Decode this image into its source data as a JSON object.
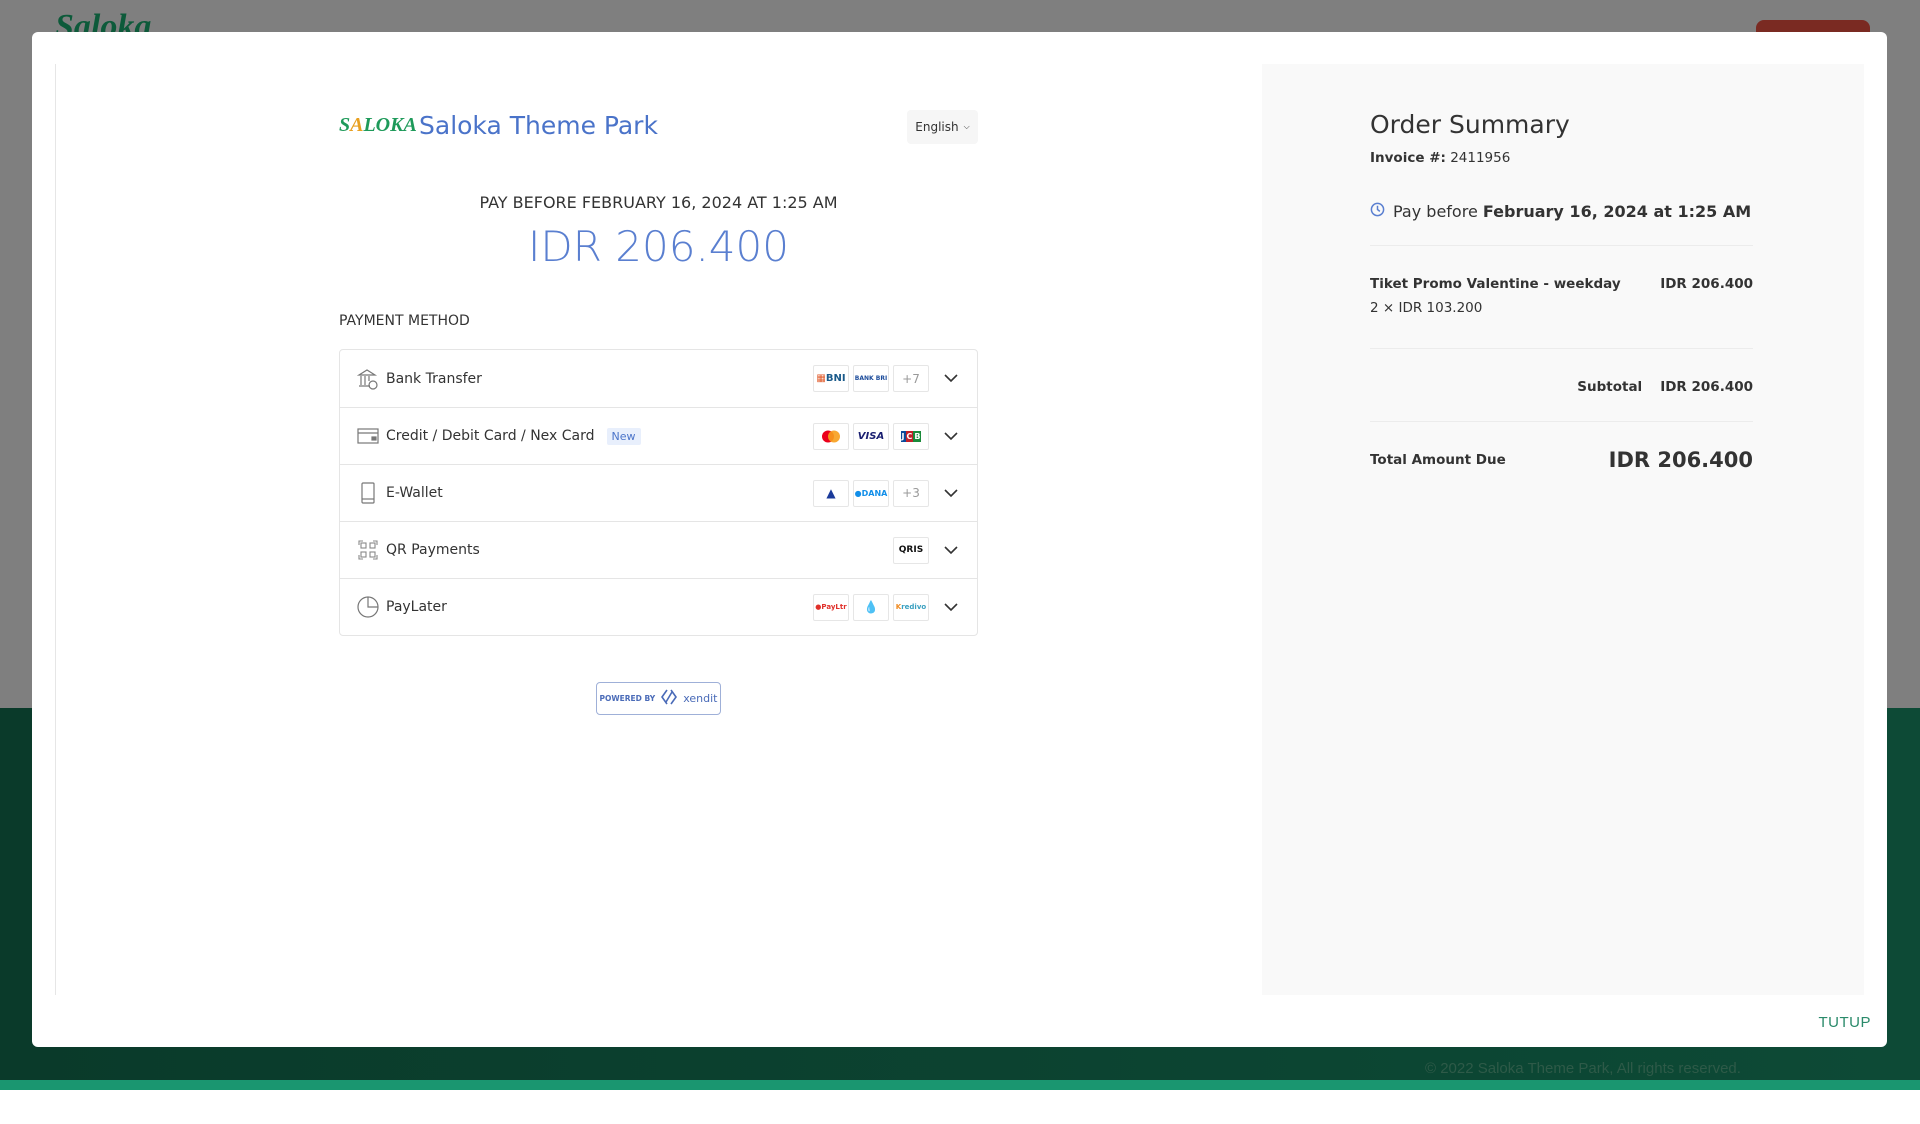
{
  "background": {
    "logo": "Saloka",
    "copyright": "© 2022 Saloka Theme Park, All rights reserved."
  },
  "header": {
    "logo_text": "Saloka",
    "brand": "Saloka Theme Park",
    "language": "English"
  },
  "payment": {
    "pay_before": "PAY BEFORE FEBRUARY 16, 2024 AT 1:25 AM",
    "amount": "IDR 206.400",
    "method_label": "PAYMENT METHOD",
    "methods": [
      {
        "label": "Bank Transfer",
        "logos": [
          "BNI",
          "BANK BRI",
          "+7"
        ]
      },
      {
        "label": "Credit / Debit Card / Nex Card",
        "badge": "New",
        "logos": [
          "Mastercard",
          "VISA",
          "JCB"
        ]
      },
      {
        "label": "E-Wallet",
        "logos": [
          "AstraPay",
          "DANA",
          "+3"
        ]
      },
      {
        "label": "QR Payments",
        "logos": [
          "QRIS"
        ]
      },
      {
        "label": "PayLater",
        "logos": [
          "Akulaku PayLater",
          "Indodana",
          "Kredivo"
        ]
      }
    ],
    "powered_by": "POWERED BY",
    "xendit": "xendit"
  },
  "summary": {
    "title": "Order Summary",
    "invoice_label": "Invoice #:",
    "invoice_number": "2411956",
    "pay_before_label": "Pay before",
    "pay_before_date": "February 16, 2024 at 1:25 AM",
    "item_name": "Tiket Promo Valentine - weekday",
    "item_amount": "IDR 206.400",
    "item_qty": "2 × IDR 103.200",
    "subtotal_label": "Subtotal",
    "subtotal_value": "IDR 206.400",
    "total_label": "Total Amount Due",
    "total_value": "IDR 206.400"
  },
  "modal": {
    "close_label": "TUTUP"
  },
  "colors": {
    "accent": "#4a73c9",
    "close": "#2a8a6a",
    "footer": "#0a3a2a"
  }
}
